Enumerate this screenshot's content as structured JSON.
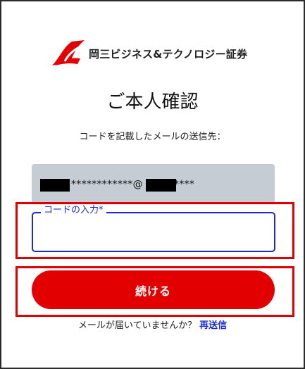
{
  "brand": {
    "name": "岡三ビジネス&テクノロジー証券",
    "logo_icon": "okasan-sail-logo-icon",
    "logo_color": "#e20000"
  },
  "page": {
    "title": "ご本人確認",
    "subtitle": "コードを記載したメールの送信先："
  },
  "email": {
    "masked_value": "************@",
    "masked_suffix": "****"
  },
  "code_field": {
    "label": "コードの入力*",
    "value": "",
    "accent_color": "#1d2bd2"
  },
  "continue_button": {
    "label": "続ける",
    "color": "#e20000"
  },
  "resend": {
    "prompt": "メールが届いていませんか？",
    "link_label": "再送信"
  },
  "annotations": {
    "highlight_color": "#e00000"
  }
}
